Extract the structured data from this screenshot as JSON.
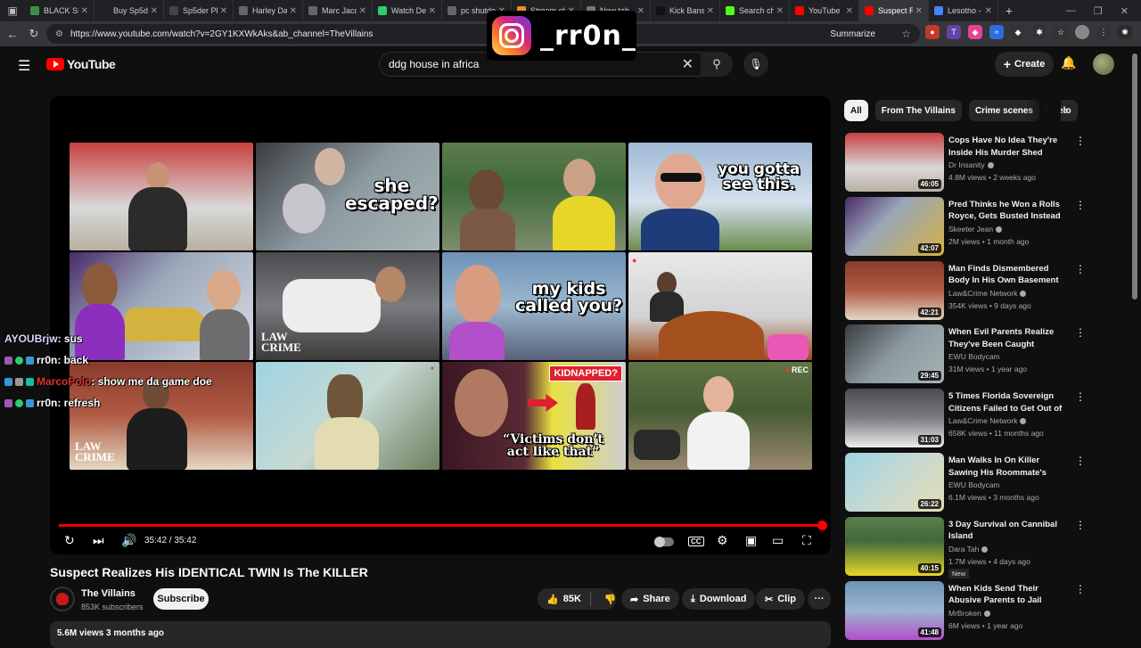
{
  "browser": {
    "tabs": [
      {
        "label": "BLACK SEX",
        "color": "#3d8f4a",
        "active": false
      },
      {
        "label": "Buy Sp5der",
        "color": "#222222",
        "active": false
      },
      {
        "label": "Sp5der Ph",
        "color": "#444444",
        "active": false
      },
      {
        "label": "Harley Dav",
        "color": "#666666",
        "active": false
      },
      {
        "label": "Marc Jacob",
        "color": "#666666",
        "active": false
      },
      {
        "label": "Watch Dev",
        "color": "#2ecc71",
        "active": false
      },
      {
        "label": "pc shutdo",
        "color": "#666666",
        "active": false
      },
      {
        "label": "Stream ch",
        "color": "#f28c28",
        "active": false
      },
      {
        "label": "New tab",
        "color": "#777777",
        "active": false
      },
      {
        "label": "Kick Bans",
        "color": "#111111",
        "active": false
      },
      {
        "label": "Search ch",
        "color": "#53fc18",
        "active": false
      },
      {
        "label": "YouTube",
        "color": "#ff0000",
        "active": false
      },
      {
        "label": "Suspect Re",
        "color": "#ff0000",
        "active": true
      },
      {
        "label": "Lesotho -",
        "color": "#4285f4",
        "active": false
      }
    ],
    "url": "https://www.youtube.com/watch?v=2GY1KXWkAks&ab_channel=TheVillains",
    "summarize_label": "Summarize"
  },
  "overlay": {
    "instagram_handle": "_rr0n_"
  },
  "youtube": {
    "logo_text": "YouTube",
    "search_value": "ddg house in africa",
    "create_label": "Create"
  },
  "player": {
    "captions": {
      "c2": "she\nescaped?",
      "c4": "you gotta\nsee this.",
      "c7": "my kids\ncalled you?",
      "c11": "“Victims don’t\nact like that”",
      "kidnapped": "KIDNAPPED?",
      "law": "LAW\nCRIME",
      "rec": "REC"
    },
    "time": "35:42 / 35:42",
    "progress": 1.0
  },
  "chat": [
    {
      "user": "AYOUBrjw",
      "message": " : sus"
    },
    {
      "user": "rr0n",
      "message": " : back"
    },
    {
      "user": "MarcoPolo",
      "message": " : show me da game doe"
    },
    {
      "user": "rr0n",
      "message": " : refresh"
    }
  ],
  "video": {
    "title": "Suspect Realizes His IDENTICAL TWIN Is The KILLER",
    "channel": "The Villains",
    "subscribers": "853K subscribers",
    "subscribe_label": "Subscribe",
    "likes": "85K",
    "share_label": "Share",
    "download_label": "Download",
    "clip_label": "Clip",
    "views_date": "5.6M views  3 months ago"
  },
  "chips": [
    "All",
    "From The Villains",
    "Crime scenes",
    "Felo"
  ],
  "recommendations": [
    {
      "title": "Cops Have No Idea They're Inside His Murder Shed",
      "channel": "Dr Insanity",
      "meta": "4.8M views • 2 weeks ago",
      "duration": "46:05",
      "verified": true,
      "new": false
    },
    {
      "title": "Pred Thinks he Won a Rolls Royce, Gets Busted Instead",
      "channel": "Skeeter Jean",
      "meta": "2M views • 1 month ago",
      "duration": "42:07",
      "verified": true,
      "new": false
    },
    {
      "title": "Man Finds Dismembered Body In His Own Basement",
      "channel": "Law&Crime Network",
      "meta": "354K views • 9 days ago",
      "duration": "42:21",
      "verified": true,
      "new": false
    },
    {
      "title": "When Evil Parents Realize They've Been Caught",
      "channel": "EWU Bodycam",
      "meta": "31M views • 1 year ago",
      "duration": "29:45",
      "verified": false,
      "new": false
    },
    {
      "title": "5 Times Florida Sovereign Citizens Failed to Get Out of ...",
      "channel": "Law&Crime Network",
      "meta": "658K views • 11 months ago",
      "duration": "31:03",
      "verified": true,
      "new": false
    },
    {
      "title": "Man Walks In On Killer Sawing His Roommate's Neck",
      "channel": "EWU Bodycam",
      "meta": "6.1M views • 3 months ago",
      "duration": "26:22",
      "verified": false,
      "new": false
    },
    {
      "title": "3 Day Survival on Cannibal Island",
      "channel": "Dara Tah",
      "meta": "1.7M views • 4 days ago",
      "duration": "40:15",
      "verified": true,
      "new": true,
      "new_label": "New"
    },
    {
      "title": "When Kids Send Their Abusive Parents to Jail",
      "channel": "MrBroken",
      "meta": "6M views • 1 year ago",
      "duration": "41:48",
      "verified": true,
      "new": false
    }
  ]
}
